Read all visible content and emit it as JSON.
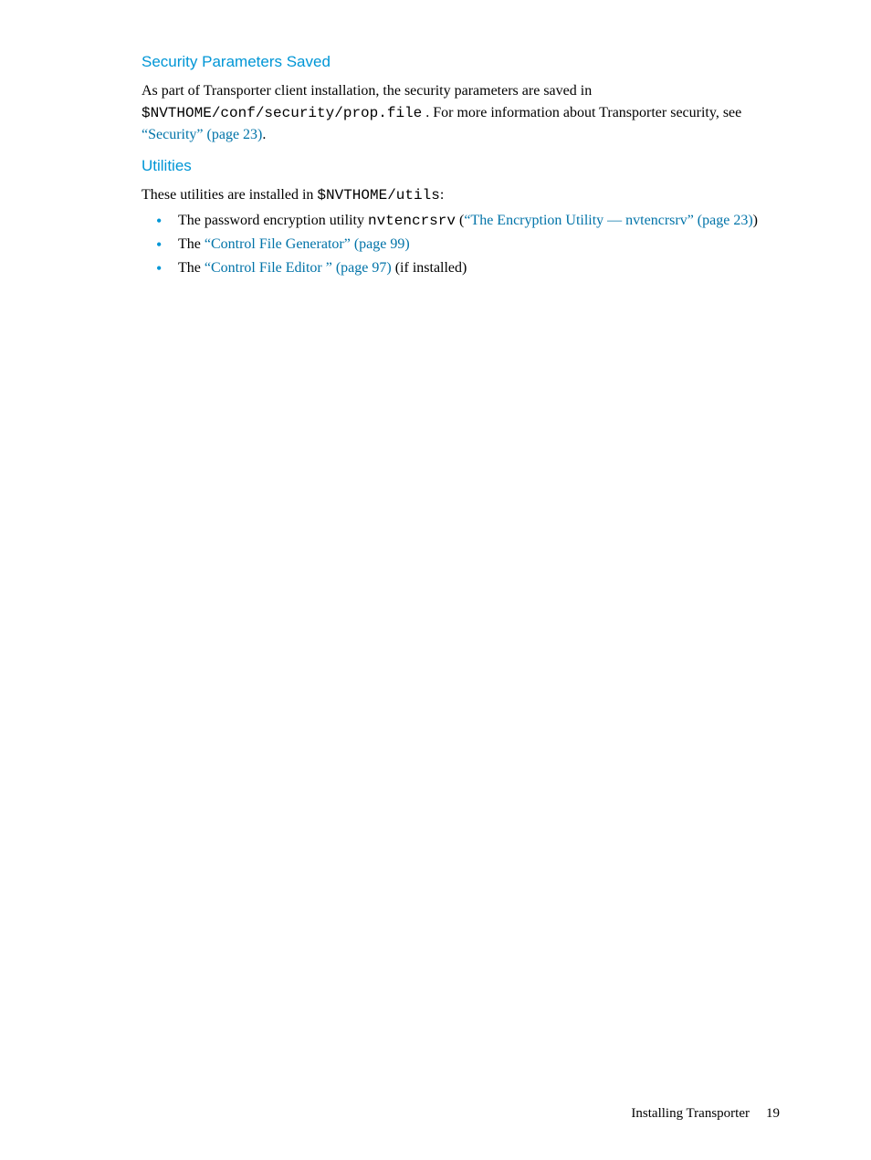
{
  "section1": {
    "heading": "Security Parameters Saved",
    "p1_a": "As part of Transporter client installation, the security parameters are saved in ",
    "p1_code": "$NVTHOME/conf/security/prop.file",
    "p1_b": " . For more information about Transporter security, see ",
    "p1_link": "“Security” (page 23)",
    "p1_c": "."
  },
  "section2": {
    "heading": "Utilities",
    "intro_a": "These utilities are installed in ",
    "intro_code": "$NVTHOME/utils",
    "intro_b": ":",
    "items": [
      {
        "a": "The password encryption utility ",
        "code": "nvtencrsrv",
        "b": " (",
        "link": "“The Encryption Utility — nvtencrsrv” (page 23)",
        "c": ")"
      },
      {
        "a": "The ",
        "link": "“Control File Generator” (page 99)",
        "c": ""
      },
      {
        "a": "The ",
        "link": "“Control File Editor ” (page 97)",
        "c": " (if installed)"
      }
    ]
  },
  "footer": {
    "title": "Installing Transporter",
    "page": "19"
  }
}
